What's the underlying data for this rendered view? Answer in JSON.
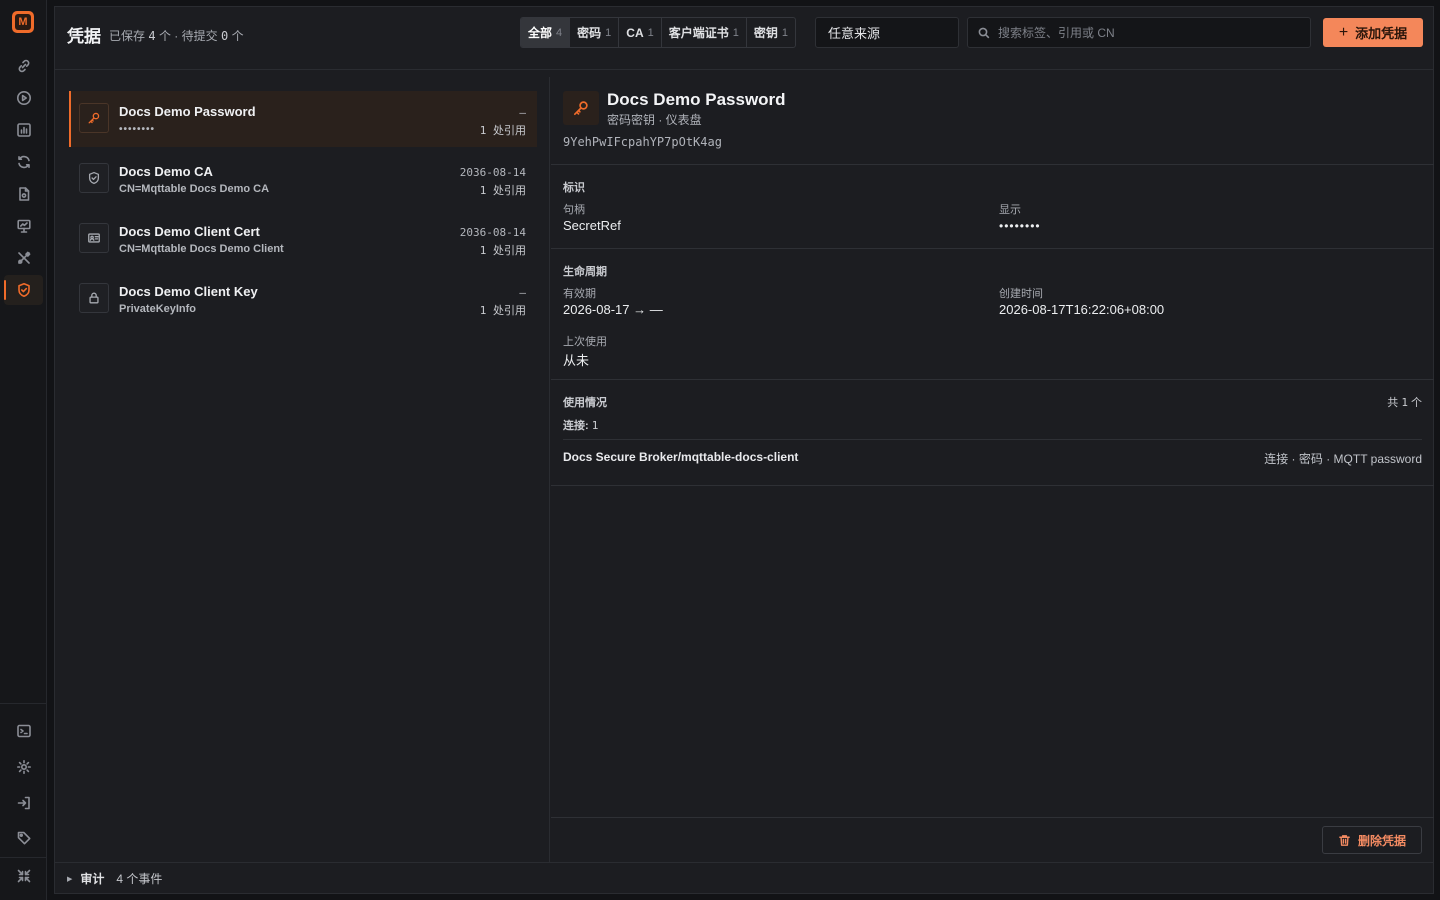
{
  "app": {
    "logo_letter": "M"
  },
  "header": {
    "title": "凭据",
    "saved_label": "已保存",
    "saved_count": "4",
    "count_unit": "个",
    "separator": "·",
    "pending_label": "待提交",
    "pending_count": "0",
    "filters": [
      {
        "label": "全部",
        "count": "4"
      },
      {
        "label": "密码",
        "count": "1"
      },
      {
        "label": "CA",
        "count": "1"
      },
      {
        "label": "客户端证书",
        "count": "1"
      },
      {
        "label": "密钥",
        "count": "1"
      }
    ],
    "source_value": "任意来源",
    "search_placeholder": "搜索标签、引用或 CN",
    "add_label": "添加凭据"
  },
  "credentials": [
    {
      "name": "Docs Demo Password",
      "sub": "••••••••",
      "date": "—",
      "refs": "1 处引用",
      "icon": "key-icon"
    },
    {
      "name": "Docs Demo CA",
      "sub": "CN=Mqttable Docs Demo CA",
      "date": "2036-08-14",
      "refs": "1 处引用",
      "icon": "shield-check-icon"
    },
    {
      "name": "Docs Demo Client Cert",
      "sub": "CN=Mqttable Docs Demo Client",
      "date": "2036-08-14",
      "refs": "1 处引用",
      "icon": "id-card-icon"
    },
    {
      "name": "Docs Demo Client Key",
      "sub": "PrivateKeyInfo",
      "date": "—",
      "refs": "1 处引用",
      "icon": "lock-icon"
    }
  ],
  "detail": {
    "title": "Docs Demo Password",
    "subtitle": "密码密钥 · 仪表盘",
    "id": "9YehPwIFcpahYP7pOtK4ag",
    "identity": {
      "section": "标识",
      "handle_label": "句柄",
      "handle_value": "SecretRef",
      "display_label": "显示",
      "display_value": "••••••••"
    },
    "lifecycle": {
      "section": "生命周期",
      "validity_label": "有效期",
      "validity_value": "2026-08-17 → —",
      "created_label": "创建时间",
      "created_value": "2026-08-17T16:22:06+08:00",
      "last_used_label": "上次使用",
      "last_used_value": "从未"
    },
    "usage": {
      "section": "使用情况",
      "total_prefix": "共",
      "total_count": "1",
      "total_unit": "个",
      "connections_label": "连接:",
      "connections_count": "1",
      "items": [
        {
          "name": "Docs Secure Broker/mqttable-docs-client",
          "meta": "连接 · 密码 · MQTT password"
        }
      ]
    },
    "delete_label": "删除凭据"
  },
  "audit": {
    "label": "审计",
    "count": "4 个事件"
  },
  "colors": {
    "accent": "#ef6b2a",
    "background": "#1c1d21",
    "add_button": "#f4875a"
  }
}
